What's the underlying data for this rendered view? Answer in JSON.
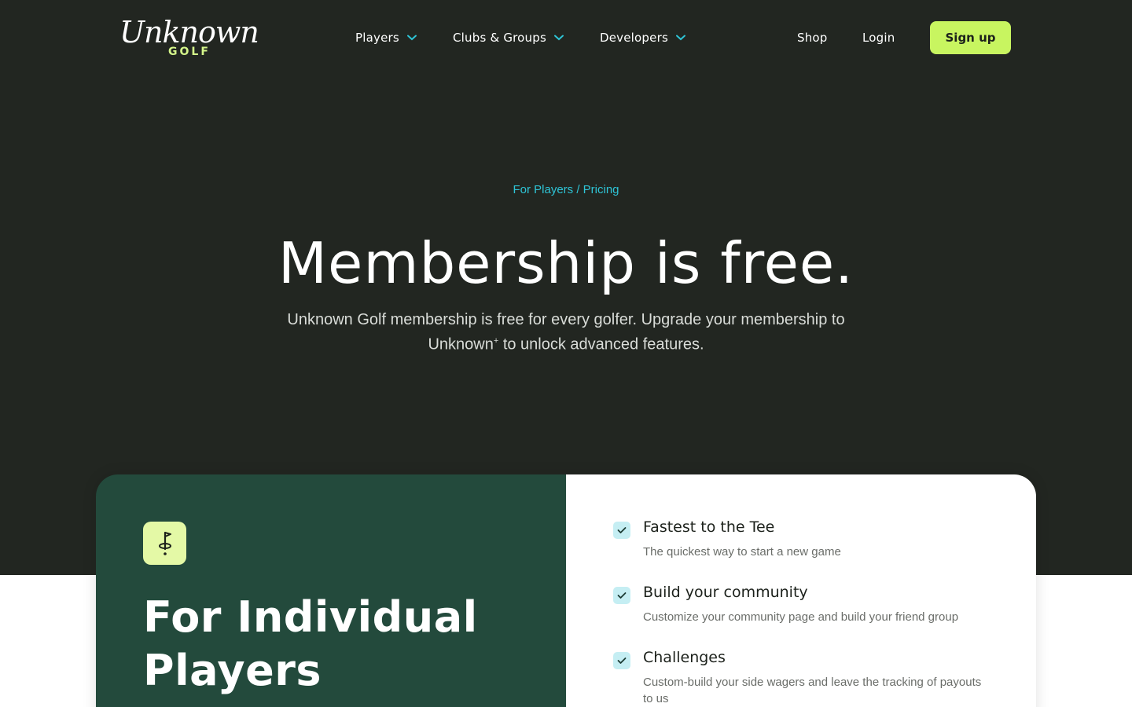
{
  "nav": {
    "logo_script": "Unknown",
    "logo_golf": "GOLF",
    "items": [
      {
        "label": "Players"
      },
      {
        "label": "Clubs & Groups"
      },
      {
        "label": "Developers"
      }
    ],
    "shop": "Shop",
    "login": "Login",
    "signup": "Sign up"
  },
  "hero": {
    "breadcrumb": "For Players / Pricing",
    "title": "Membership is free.",
    "subtitle_pre": "Unknown Golf membership is free for every golfer. Upgrade your membership to Unknown",
    "subtitle_sup": "+",
    "subtitle_post": " to unlock advanced features."
  },
  "card": {
    "icon": "golf-flag-icon",
    "title": "For Individual Players",
    "features": [
      {
        "title": "Fastest to the Tee",
        "desc": "The quickest way to start a new game"
      },
      {
        "title": "Build your community",
        "desc": "Customize your community page and build your friend group"
      },
      {
        "title": "Challenges",
        "desc": "Custom-build your side wagers and leave the tracking of payouts to us"
      }
    ]
  },
  "colors": {
    "hero_bg": "#222621",
    "accent_lime": "#c8f560",
    "accent_cyan": "#2ec4d6",
    "card_green": "#234a3c"
  }
}
